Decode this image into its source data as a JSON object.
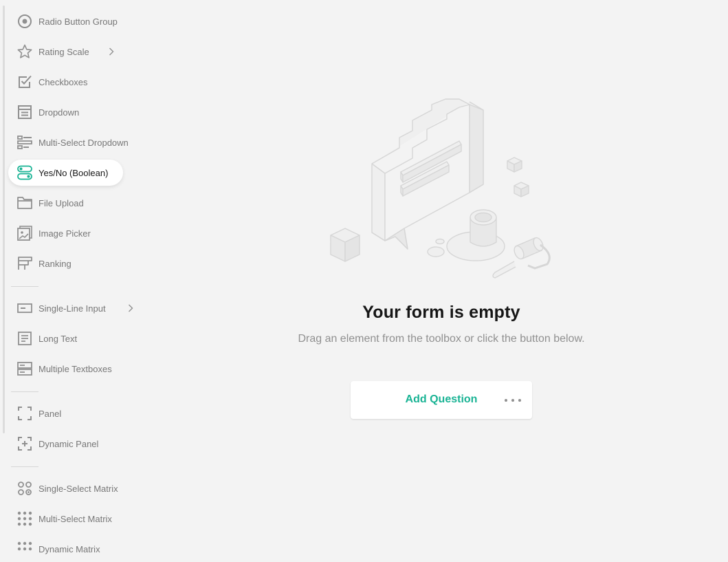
{
  "toolbox": {
    "items": [
      {
        "label": "Radio Button Group",
        "icon": "radio-button-icon"
      },
      {
        "label": "Rating Scale",
        "icon": "star-icon",
        "has_submenu": true
      },
      {
        "label": "Checkboxes",
        "icon": "checkbox-icon"
      },
      {
        "label": "Dropdown",
        "icon": "dropdown-icon"
      },
      {
        "label": "Multi-Select Dropdown",
        "icon": "multi-select-dropdown-icon"
      },
      {
        "label": "Yes/No (Boolean)",
        "icon": "toggle-icon",
        "active": true
      },
      {
        "label": "File Upload",
        "icon": "folder-icon"
      },
      {
        "label": "Image Picker",
        "icon": "image-icon"
      },
      {
        "label": "Ranking",
        "icon": "ranking-icon"
      },
      {
        "label": "Single-Line Input",
        "icon": "single-line-input-icon",
        "has_submenu": true
      },
      {
        "label": "Long Text",
        "icon": "long-text-icon"
      },
      {
        "label": "Multiple Textboxes",
        "icon": "multiple-textboxes-icon"
      },
      {
        "label": "Panel",
        "icon": "panel-icon"
      },
      {
        "label": "Dynamic Panel",
        "icon": "dynamic-panel-icon"
      },
      {
        "label": "Single-Select Matrix",
        "icon": "single-select-matrix-icon"
      },
      {
        "label": "Multi-Select Matrix",
        "icon": "multi-select-matrix-icon"
      },
      {
        "label": "Dynamic Matrix",
        "icon": "dynamic-matrix-icon"
      }
    ]
  },
  "empty_state": {
    "title": "Your form is empty",
    "subtitle": "Drag an element from the toolbox or click the button below.",
    "illustration": "empty-form-illustration"
  },
  "actions": {
    "add_question": "Add Question",
    "more_icon": "more-horizontal-icon"
  },
  "colors": {
    "accent": "#19b394",
    "background": "#f3f3f3",
    "icon": "#909090",
    "active_icon": "#19b394"
  }
}
